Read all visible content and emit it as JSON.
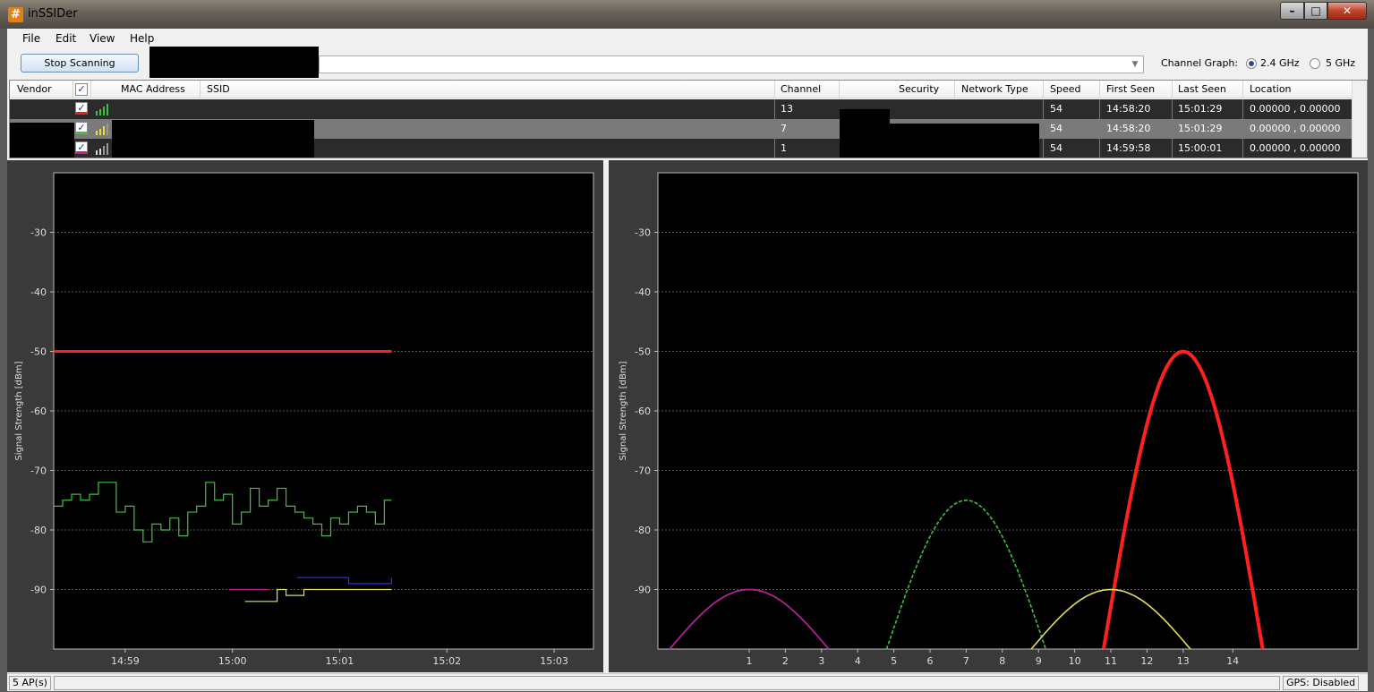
{
  "window": {
    "title": "inSSIDer",
    "icon": "#"
  },
  "window_controls": {
    "minimize": "–",
    "maximize": "□",
    "close": "✕"
  },
  "menu": [
    "File",
    "Edit",
    "View",
    "Help"
  ],
  "toolbar": {
    "scan_button": "Stop Scanning",
    "channel_graph_label": "Channel Graph:",
    "band_options": [
      "2.4 GHz",
      "5 GHz"
    ],
    "selected_band": "2.4 GHz"
  },
  "table": {
    "columns": [
      "Vendor",
      "MAC Address",
      "SSID",
      "Channel",
      "Security",
      "Network Type",
      "Speed",
      "First Seen",
      "Last Seen",
      "Location"
    ],
    "rows": [
      {
        "color": "#e82020",
        "channel": "13",
        "speed": "54",
        "first_seen": "14:58:20",
        "last_seen": "15:01:29",
        "location": "0.00000 , 0.00000"
      },
      {
        "color": "#40c040",
        "channel": "7",
        "speed": "54",
        "first_seen": "14:58:20",
        "last_seen": "15:01:29",
        "location": "0.00000 , 0.00000"
      },
      {
        "color": "#c02090",
        "channel": "1",
        "speed": "54",
        "first_seen": "14:59:58",
        "last_seen": "15:00:01",
        "location": "0.00000 , 0.00000"
      }
    ]
  },
  "chart_data": [
    {
      "type": "line",
      "ylabel": "Signal Strength [dBm]",
      "yticks": [
        "-30",
        "-40",
        "-50",
        "-60",
        "-70",
        "-80",
        "-90"
      ],
      "ylim": [
        -100,
        -20
      ],
      "xticks": [
        "14:59",
        "15:00",
        "15:01",
        "15:02",
        "15:03"
      ],
      "grid": true,
      "series": [
        {
          "color": "#ff2020",
          "x": [
            "14:58:20",
            "15:01:29"
          ],
          "y": [
            -50,
            -50
          ]
        },
        {
          "color": "#40c040",
          "x": [
            "14:58:20",
            "14:58:25",
            "14:58:30",
            "14:58:35",
            "14:58:40",
            "14:58:45",
            "14:58:50",
            "14:58:55",
            "14:59:00",
            "14:59:05",
            "14:59:10",
            "14:59:15",
            "14:59:20",
            "14:59:25",
            "14:59:30",
            "14:59:35",
            "14:59:40",
            "14:59:45",
            "14:59:50",
            "14:59:55",
            "15:00:00",
            "15:00:05",
            "15:00:10",
            "15:00:15",
            "15:00:20",
            "15:00:25",
            "15:00:30",
            "15:00:35",
            "15:00:40",
            "15:00:45",
            "15:00:50",
            "15:00:55",
            "15:01:00",
            "15:01:05",
            "15:01:10",
            "15:01:15",
            "15:01:20",
            "15:01:25",
            "15:01:29"
          ],
          "y": [
            -76,
            -75,
            -74,
            -75,
            -74,
            -72,
            -72,
            -77,
            -76,
            -80,
            -82,
            -79,
            -80,
            -78,
            -81,
            -77,
            -76,
            -72,
            -75,
            -74,
            -79,
            -77,
            -73,
            -76,
            -75,
            -73,
            -76,
            -77,
            -78,
            -79,
            -81,
            -78,
            -79,
            -77,
            -76,
            -77,
            -79,
            -75,
            -75
          ]
        },
        {
          "color": "#2d2dff",
          "x": [
            "15:00:36",
            "15:00:50",
            "15:01:05",
            "15:01:29"
          ],
          "y": [
            -88,
            -88,
            -89,
            -88
          ]
        },
        {
          "color": "#e0e060",
          "x": [
            "15:00:07",
            "15:00:20",
            "15:00:25",
            "15:00:30",
            "15:00:40",
            "15:01:29"
          ],
          "y": [
            -92,
            -92,
            -90,
            -91,
            -90,
            -90
          ]
        },
        {
          "color": "#c02090",
          "x": [
            "14:59:58",
            "15:00:20"
          ],
          "y": [
            -90,
            -90
          ]
        }
      ]
    },
    {
      "type": "area",
      "ylabel": "Signal Strength [dBm]",
      "yticks": [
        "-30",
        "-40",
        "-50",
        "-60",
        "-70",
        "-80",
        "-90"
      ],
      "ylim": [
        -100,
        -20
      ],
      "xticks": [
        "1",
        "2",
        "3",
        "4",
        "5",
        "6",
        "7",
        "8",
        "9",
        "10",
        "11",
        "12",
        "13",
        "14"
      ],
      "grid": true,
      "series": [
        {
          "color": "#ff2020",
          "channel": 13,
          "peak": -50
        },
        {
          "color": "#40c040",
          "channel": 7,
          "peak": -75,
          "dashed": true
        },
        {
          "color": "#e0e060",
          "channel": 11,
          "peak": -90
        },
        {
          "color": "#2d2dff",
          "channel": 1,
          "peak": -90
        },
        {
          "color": "#c02090",
          "channel": 1,
          "peak": -90
        }
      ]
    }
  ],
  "status": {
    "ap_count": "5 AP(s)",
    "gps": "GPS: Disabled"
  }
}
